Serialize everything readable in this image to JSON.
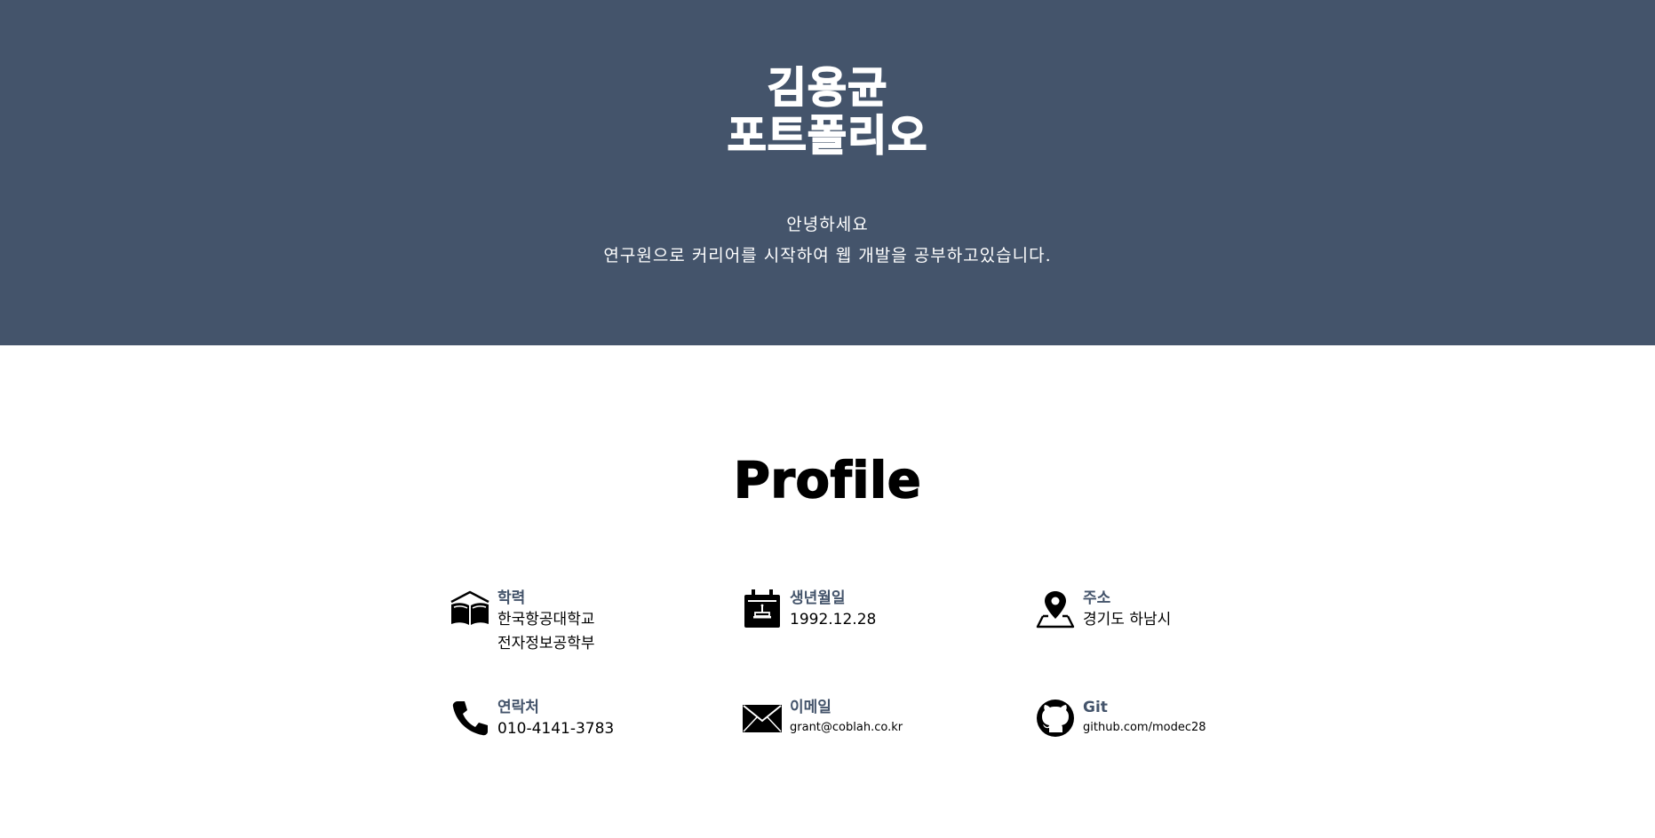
{
  "hero": {
    "title_line1": "김용균",
    "title_line2": "포트폴리오",
    "greeting_line1": "안녕하세요",
    "greeting_line2": "연구원으로 커리어를 시작하여 웹 개발을 공부하고있습니다."
  },
  "profile": {
    "title": "Profile",
    "items": [
      {
        "icon": "book-icon",
        "label": "학력",
        "values": [
          "한국항공대학교",
          "전자정보공학부"
        ]
      },
      {
        "icon": "calendar-cake-icon",
        "label": "생년월일",
        "values": [
          "1992.12.28"
        ]
      },
      {
        "icon": "map-pin-icon",
        "label": "주소",
        "values": [
          "경기도 하남시"
        ]
      },
      {
        "icon": "phone-icon",
        "label": "연락처",
        "values": [
          "010-4141-3783"
        ]
      },
      {
        "icon": "envelope-icon",
        "label": "이메일",
        "values": [
          "grant@coblah.co.kr"
        ]
      },
      {
        "icon": "github-icon",
        "label": "Git",
        "values": [
          "github.com/modec28"
        ]
      }
    ]
  },
  "colors": {
    "hero_background": "#44546b",
    "label_color": "#44546b",
    "text": "#000000",
    "page_background": "#ffffff"
  }
}
